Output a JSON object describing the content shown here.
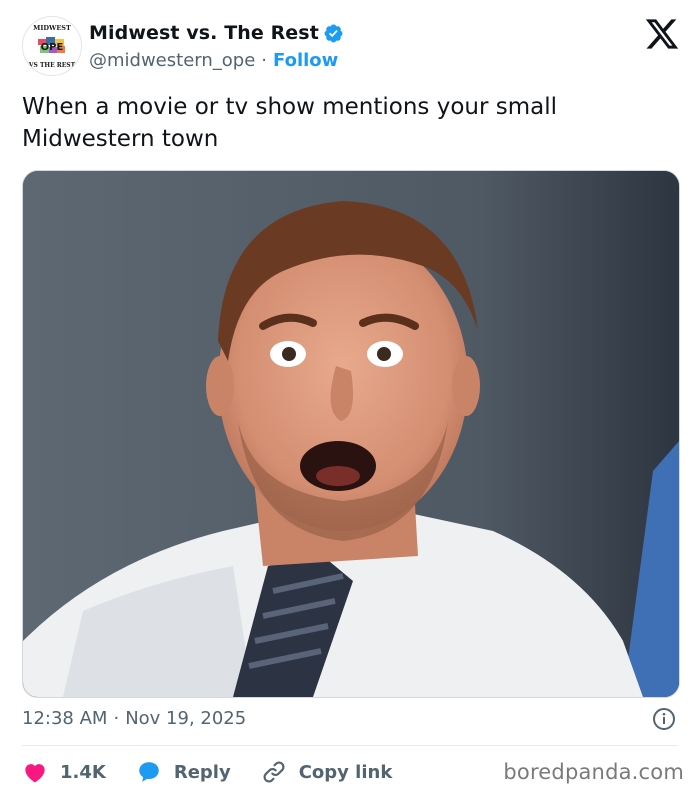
{
  "tweet": {
    "display_name": "Midwest vs. The Rest",
    "handle": "@midwestern_ope",
    "separator": "·",
    "follow_label": "Follow",
    "text": "When a movie or tv show mentions your small Midwestern town",
    "time": "12:38 AM",
    "date": "Nov 19, 2025"
  },
  "avatar": {
    "top_text": "MIDWEST",
    "center_text": "OPE",
    "bottom_text": "VS THE REST"
  },
  "actions": {
    "like_count": "1.4K",
    "reply_label": "Reply",
    "copy_link_label": "Copy link"
  },
  "watermark": "boredpanda.com",
  "icons": {
    "verified": "verified-badge-icon",
    "x_logo": "x-logo-icon",
    "info": "info-icon",
    "like": "heart-icon",
    "reply": "chat-bubble-icon",
    "copy": "link-icon"
  },
  "colors": {
    "like": "#f91880",
    "reply": "#1d9bf0",
    "follow": "#1d9bf0",
    "verified": "#1d9bf0"
  }
}
